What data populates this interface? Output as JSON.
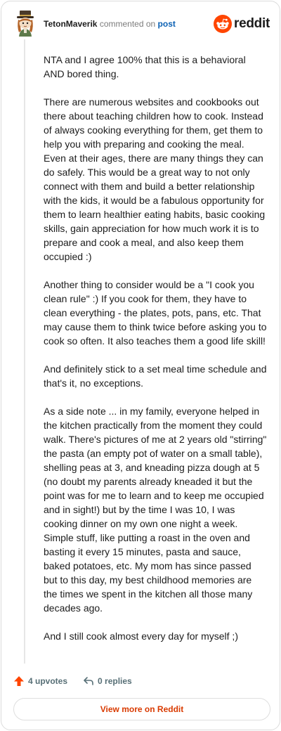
{
  "header": {
    "username": "TetonMaverik",
    "verb": "commented on",
    "post_link": "post",
    "brand": "reddit"
  },
  "comment": {
    "paragraphs": [
      "NTA and I agree 100% that this is a behavioral AND bored thing.",
      "There are numerous websites and cookbooks out there about teaching children how to cook. Instead of always cooking everything for them, get them to help you with preparing and cooking the meal. Even at their ages, there are many things they can do safely. This would be a great way to not only connect with them and build a better relationship with the kids, it would be a fabulous opportunity for them to learn healthier eating habits, basic cooking skills, gain appreciation for how much work it is to prepare and cook a meal, and also keep them occupied :)",
      "Another thing to consider would be a \"I cook you clean rule\" :) If you cook for them, they have to clean everything - the plates, pots, pans, etc. That may cause them to think twice before asking you to cook so often. It also teaches them a good life skill!",
      "And definitely stick to a set meal time schedule and that's it, no exceptions.",
      "As a side note ... in my family, everyone helped in the kitchen practically from the moment they could walk. There's pictures of me at 2 years old \"stirring\" the pasta (an empty pot of water on a small table), shelling peas at 3, and kneading pizza dough at 5 (no doubt my parents already kneaded it but the point was for me to learn and to keep me occupied and in sight!) but by the time I was 10, I was cooking dinner on my own one night a week. Simple stuff, like putting a roast in the oven and basting it every 15 minutes, pasta and sauce, baked potatoes, etc. My mom has since passed but to this day, my best childhood memories are the times we spent in the kitchen all those many decades ago.",
      "And I still cook almost every day for myself ;)"
    ]
  },
  "actions": {
    "upvotes": "4 upvotes",
    "replies": "0 replies"
  },
  "footer": {
    "view_more": "View more on Reddit"
  },
  "colors": {
    "reddit_orange": "#ff4500",
    "link_blue": "#0b61b4",
    "cta_orange": "#d93a00",
    "muted": "#576f76"
  }
}
